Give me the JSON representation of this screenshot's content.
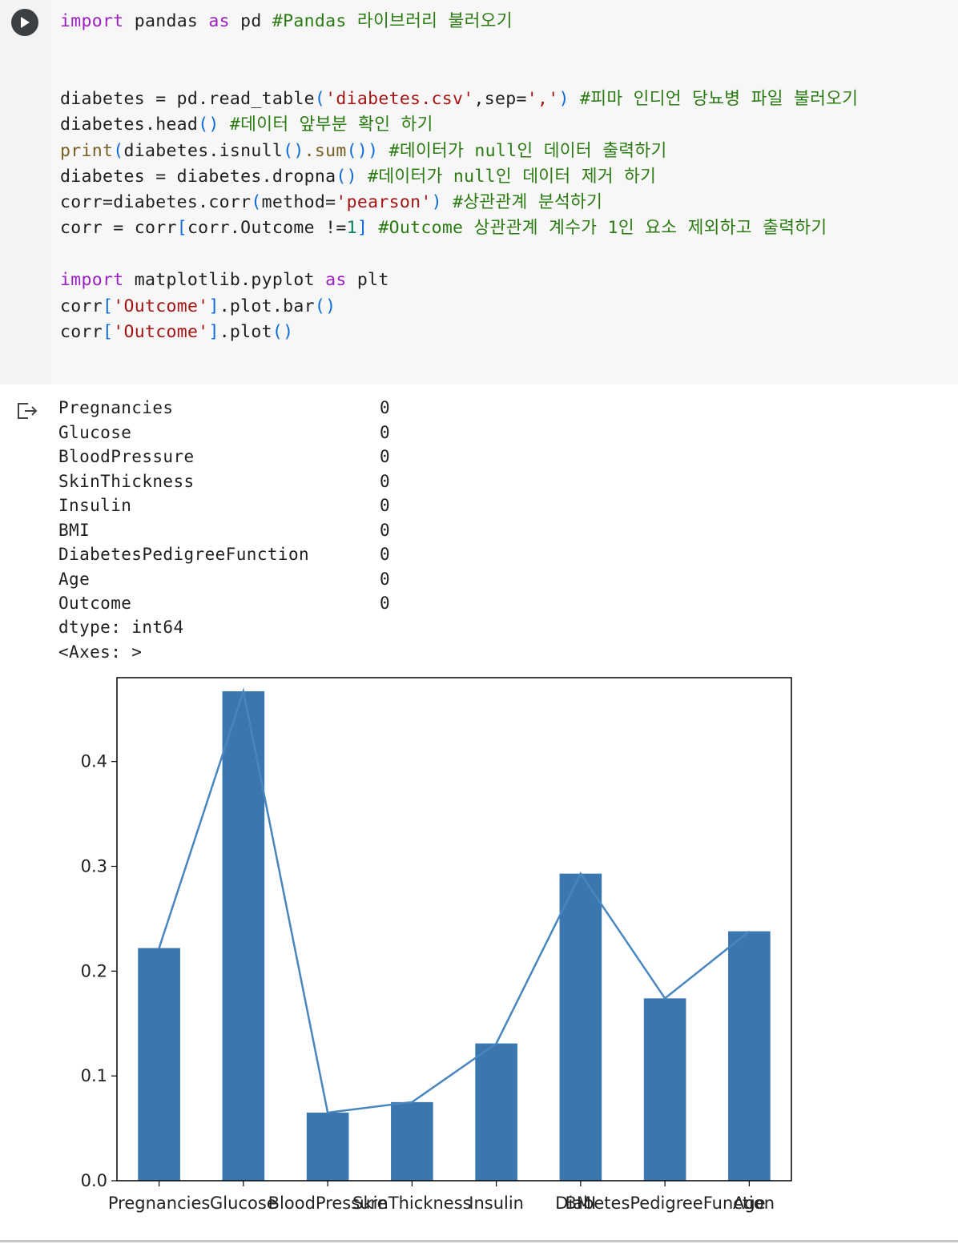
{
  "code": {
    "line1": [
      {
        "t": "import",
        "c": "kw"
      },
      {
        "t": " pandas ",
        "c": ""
      },
      {
        "t": "as",
        "c": "kw"
      },
      {
        "t": " pd ",
        "c": ""
      },
      {
        "t": "#Pandas 라이브러리 불러오기",
        "c": "cm"
      }
    ],
    "line2": [
      {
        "t": "diabetes = pd.read_table",
        "c": ""
      },
      {
        "t": "(",
        "c": "br"
      },
      {
        "t": "'diabetes.csv'",
        "c": "str"
      },
      {
        "t": ",sep=",
        "c": ""
      },
      {
        "t": "','",
        "c": "str"
      },
      {
        "t": ")",
        "c": "br"
      },
      {
        "t": " #피마 인디언 당뇨병 파일 불러오기",
        "c": "cm"
      }
    ],
    "line3": [
      {
        "t": "diabetes.head",
        "c": ""
      },
      {
        "t": "()",
        "c": "br"
      },
      {
        "t": " #데이터 앞부분 확인 하기",
        "c": "cm"
      }
    ],
    "line4": [
      {
        "t": "print",
        "c": "bi"
      },
      {
        "t": "(",
        "c": "br"
      },
      {
        "t": "diabetes.isnull",
        "c": ""
      },
      {
        "t": "()",
        "c": "br"
      },
      {
        "t": ".sum",
        "c": "bi"
      },
      {
        "t": "())",
        "c": "br"
      },
      {
        "t": " #데이터가 null인 데이터 출력하기",
        "c": "cm"
      }
    ],
    "line5": [
      {
        "t": "diabetes = diabetes.dropna",
        "c": ""
      },
      {
        "t": "()",
        "c": "br"
      },
      {
        "t": " #데이터가 null인 데이터 제거 하기",
        "c": "cm"
      }
    ],
    "line6": [
      {
        "t": "corr=diabetes.corr",
        "c": ""
      },
      {
        "t": "(",
        "c": "br"
      },
      {
        "t": "method=",
        "c": ""
      },
      {
        "t": "'pearson'",
        "c": "str"
      },
      {
        "t": ")",
        "c": "br"
      },
      {
        "t": " #상관관계 분석하기",
        "c": "cm"
      }
    ],
    "line7": [
      {
        "t": "corr = corr",
        "c": ""
      },
      {
        "t": "[",
        "c": "br"
      },
      {
        "t": "corr.Outcome !=",
        "c": ""
      },
      {
        "t": "1",
        "c": "num"
      },
      {
        "t": "]",
        "c": "br"
      },
      {
        "t": " #Outcome 상관관계 계수가 1인 요소 제외하고 출력하기",
        "c": "cm"
      }
    ],
    "line8": [
      {
        "t": "import",
        "c": "kw"
      },
      {
        "t": " matplotlib.pyplot ",
        "c": ""
      },
      {
        "t": "as",
        "c": "kw"
      },
      {
        "t": " plt",
        "c": ""
      }
    ],
    "line9": [
      {
        "t": "corr",
        "c": ""
      },
      {
        "t": "[",
        "c": "br"
      },
      {
        "t": "'Outcome'",
        "c": "str"
      },
      {
        "t": "]",
        "c": "br"
      },
      {
        "t": ".plot.bar",
        "c": ""
      },
      {
        "t": "()",
        "c": "br"
      }
    ],
    "line10": [
      {
        "t": "corr",
        "c": ""
      },
      {
        "t": "[",
        "c": "br"
      },
      {
        "t": "'Outcome'",
        "c": "str"
      },
      {
        "t": "]",
        "c": "br"
      },
      {
        "t": ".plot",
        "c": ""
      },
      {
        "t": "()",
        "c": "br"
      }
    ]
  },
  "output": {
    "rows": [
      {
        "name": "Pregnancies",
        "value": "0"
      },
      {
        "name": "Glucose",
        "value": "0"
      },
      {
        "name": "BloodPressure",
        "value": "0"
      },
      {
        "name": "SkinThickness",
        "value": "0"
      },
      {
        "name": "Insulin",
        "value": "0"
      },
      {
        "name": "BMI",
        "value": "0"
      },
      {
        "name": "DiabetesPedigreeFunction",
        "value": "0"
      },
      {
        "name": "Age",
        "value": "0"
      },
      {
        "name": "Outcome",
        "value": "0"
      }
    ],
    "dtype": "dtype: int64",
    "axes": "<Axes: >"
  },
  "icons": {
    "run": "play-icon",
    "output": "output-arrow-icon"
  },
  "colors": {
    "bar": "#3a76b0",
    "line": "#4a86be"
  },
  "chart_data": {
    "type": "bar",
    "categories": [
      "Pregnancies",
      "Glucose",
      "BloodPressure",
      "SkinThickness",
      "Insulin",
      "BMI",
      "DiabetesPedigreeFunction",
      "Age"
    ],
    "series": [
      {
        "values": [
          0.222,
          0.467,
          0.065,
          0.075,
          0.131,
          0.293,
          0.174,
          0.238
        ]
      },
      {
        "values": [
          0.222,
          0.467,
          0.065,
          0.075,
          0.131,
          0.293,
          0.174,
          0.238
        ]
      }
    ],
    "yticks": [
      "0.0",
      "0.1",
      "0.2",
      "0.3",
      "0.4"
    ],
    "ylim": [
      0,
      0.48
    ],
    "xlabel": "",
    "ylabel": "",
    "title": ""
  }
}
